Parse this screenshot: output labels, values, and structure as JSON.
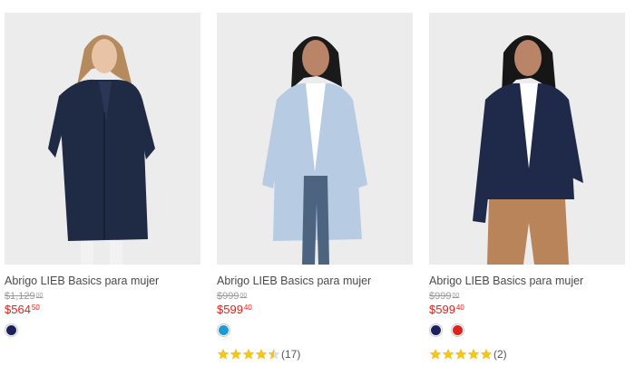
{
  "colors": {
    "price_red": "#e0221b",
    "star_yellow": "#f5c518"
  },
  "products": [
    {
      "title": "Abrigo LIEB Basics para mujer",
      "old_price": "$1,129",
      "old_price_sup": "00",
      "price": "$564",
      "price_cents": "50",
      "swatches": [
        "#1b2060"
      ],
      "rating": null,
      "reviews": "",
      "image_icon": "navy-raincoat-model-photo"
    },
    {
      "title": "Abrigo LIEB Basics para mujer",
      "old_price": "$999",
      "old_price_sup": "00",
      "price": "$599",
      "price_cents": "40",
      "swatches": [
        "#1a9bd7"
      ],
      "rating": 4.5,
      "reviews": "(17)",
      "image_icon": "light-blue-coat-model-photo"
    },
    {
      "title": "Abrigo LIEB Basics para mujer",
      "old_price": "$999",
      "old_price_sup": "00",
      "price": "$599",
      "price_cents": "40",
      "swatches": [
        "#1b2060",
        "#e0221b"
      ],
      "rating": 5,
      "reviews": "(2)",
      "image_icon": "navy-jacket-model-photo"
    }
  ]
}
